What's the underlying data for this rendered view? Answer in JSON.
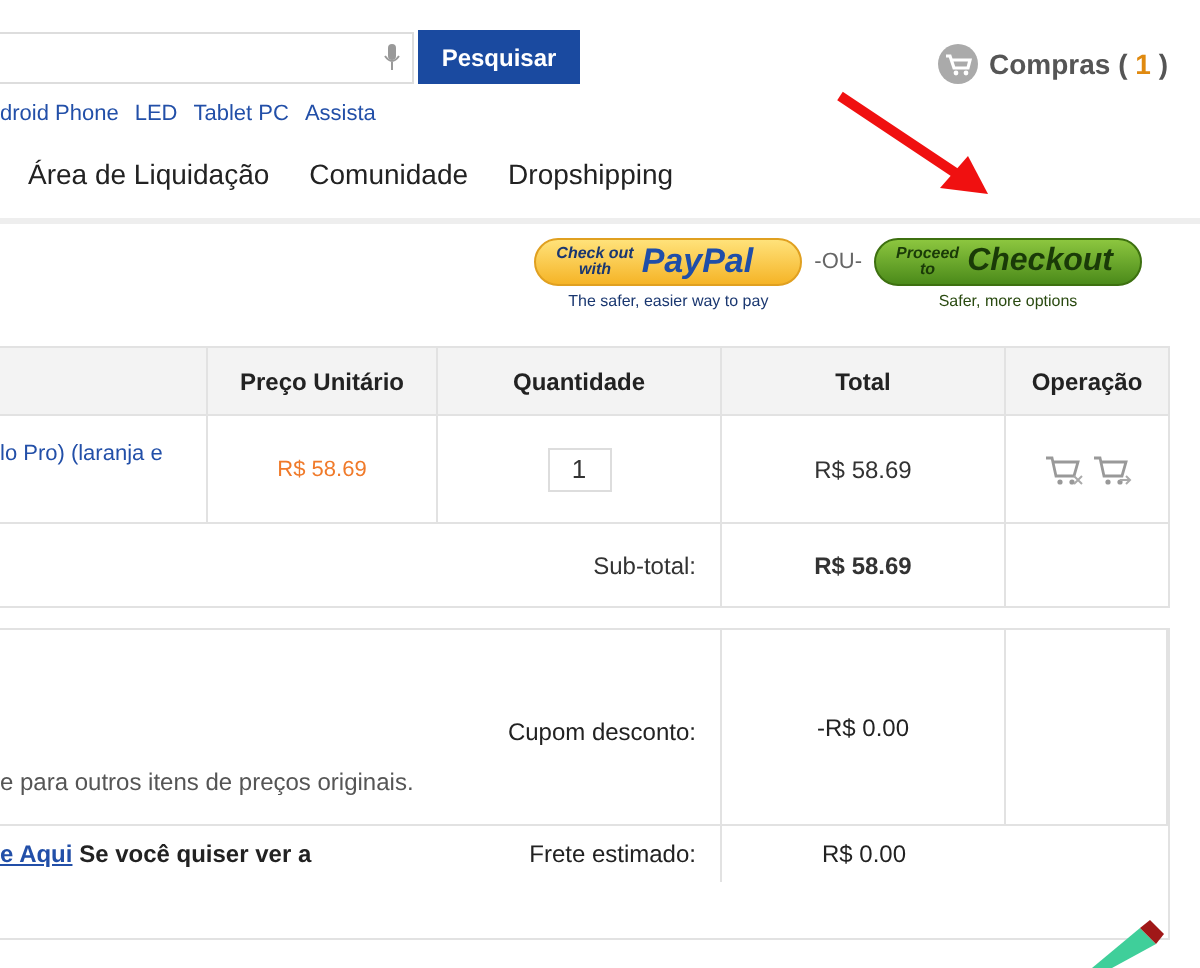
{
  "search": {
    "button": "Pesquisar"
  },
  "quick_links": [
    "droid Phone",
    "LED",
    "Tablet PC",
    "Assista"
  ],
  "cart": {
    "label": "Compras (",
    "count": "1",
    "suffix": ")"
  },
  "nav": [
    "Área de Liquidação",
    "Comunidade",
    "Dropshipping"
  ],
  "checkout": {
    "paypal": {
      "line1": "Check out",
      "line2": "with",
      "brand": "PayPal",
      "caption": "The safer, easier way to pay"
    },
    "separator": "-OU-",
    "proceed": {
      "line1": "Proceed",
      "line2": "to",
      "label": "Checkout",
      "caption": "Safer, more options"
    }
  },
  "table": {
    "columns": [
      "Preço Unitário",
      "Quantidade",
      "Total",
      "Operação"
    ],
    "rows": [
      {
        "product": "lo Pro) (laranja e",
        "unit_price": "R$ 58.69",
        "quantity": "1",
        "total": "R$ 58.69"
      }
    ],
    "subtotal": {
      "label": "Sub-total:",
      "value": "R$ 58.69"
    }
  },
  "summary": {
    "note": "e para outros itens de preços originais.",
    "coupon": {
      "label": "Cupom desconto:",
      "value": "-R$ 0.00"
    },
    "shipping_link": "e Aqui",
    "shipping_note": "Se você quiser ver a",
    "shipping": {
      "label": "Frete estimado:",
      "value": "R$ 0.00"
    }
  }
}
